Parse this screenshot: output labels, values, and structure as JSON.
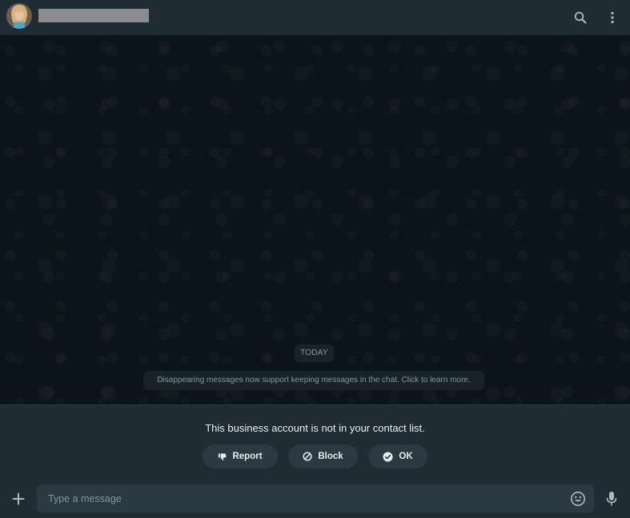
{
  "header": {
    "contact_name": "",
    "icons": {
      "search": "search-icon",
      "menu": "kebab-menu-icon",
      "avatar": "profile-photo"
    }
  },
  "chat": {
    "day_label": "TODAY",
    "system_message": "Disappearing messages now support keeping messages in the chat. Click to learn more."
  },
  "notice": {
    "text": "This business account is not in your contact list.",
    "buttons": {
      "report": {
        "label": "Report",
        "icon": "thumbs-down-icon"
      },
      "block": {
        "label": "Block",
        "icon": "block-icon"
      },
      "ok": {
        "label": "OK",
        "icon": "check-circle-icon"
      }
    }
  },
  "composer": {
    "placeholder": "Type a message",
    "value": "",
    "icons": {
      "attach": "plus-icon",
      "emoji": "emoji-icon",
      "voice": "microphone-icon"
    }
  },
  "colors": {
    "header_bg": "#202c33",
    "chat_bg": "#0b141a",
    "panel_bg": "#202c33",
    "button_bg": "#2a3942",
    "primary_text": "#e9edef",
    "secondary_text": "#8696a0"
  }
}
